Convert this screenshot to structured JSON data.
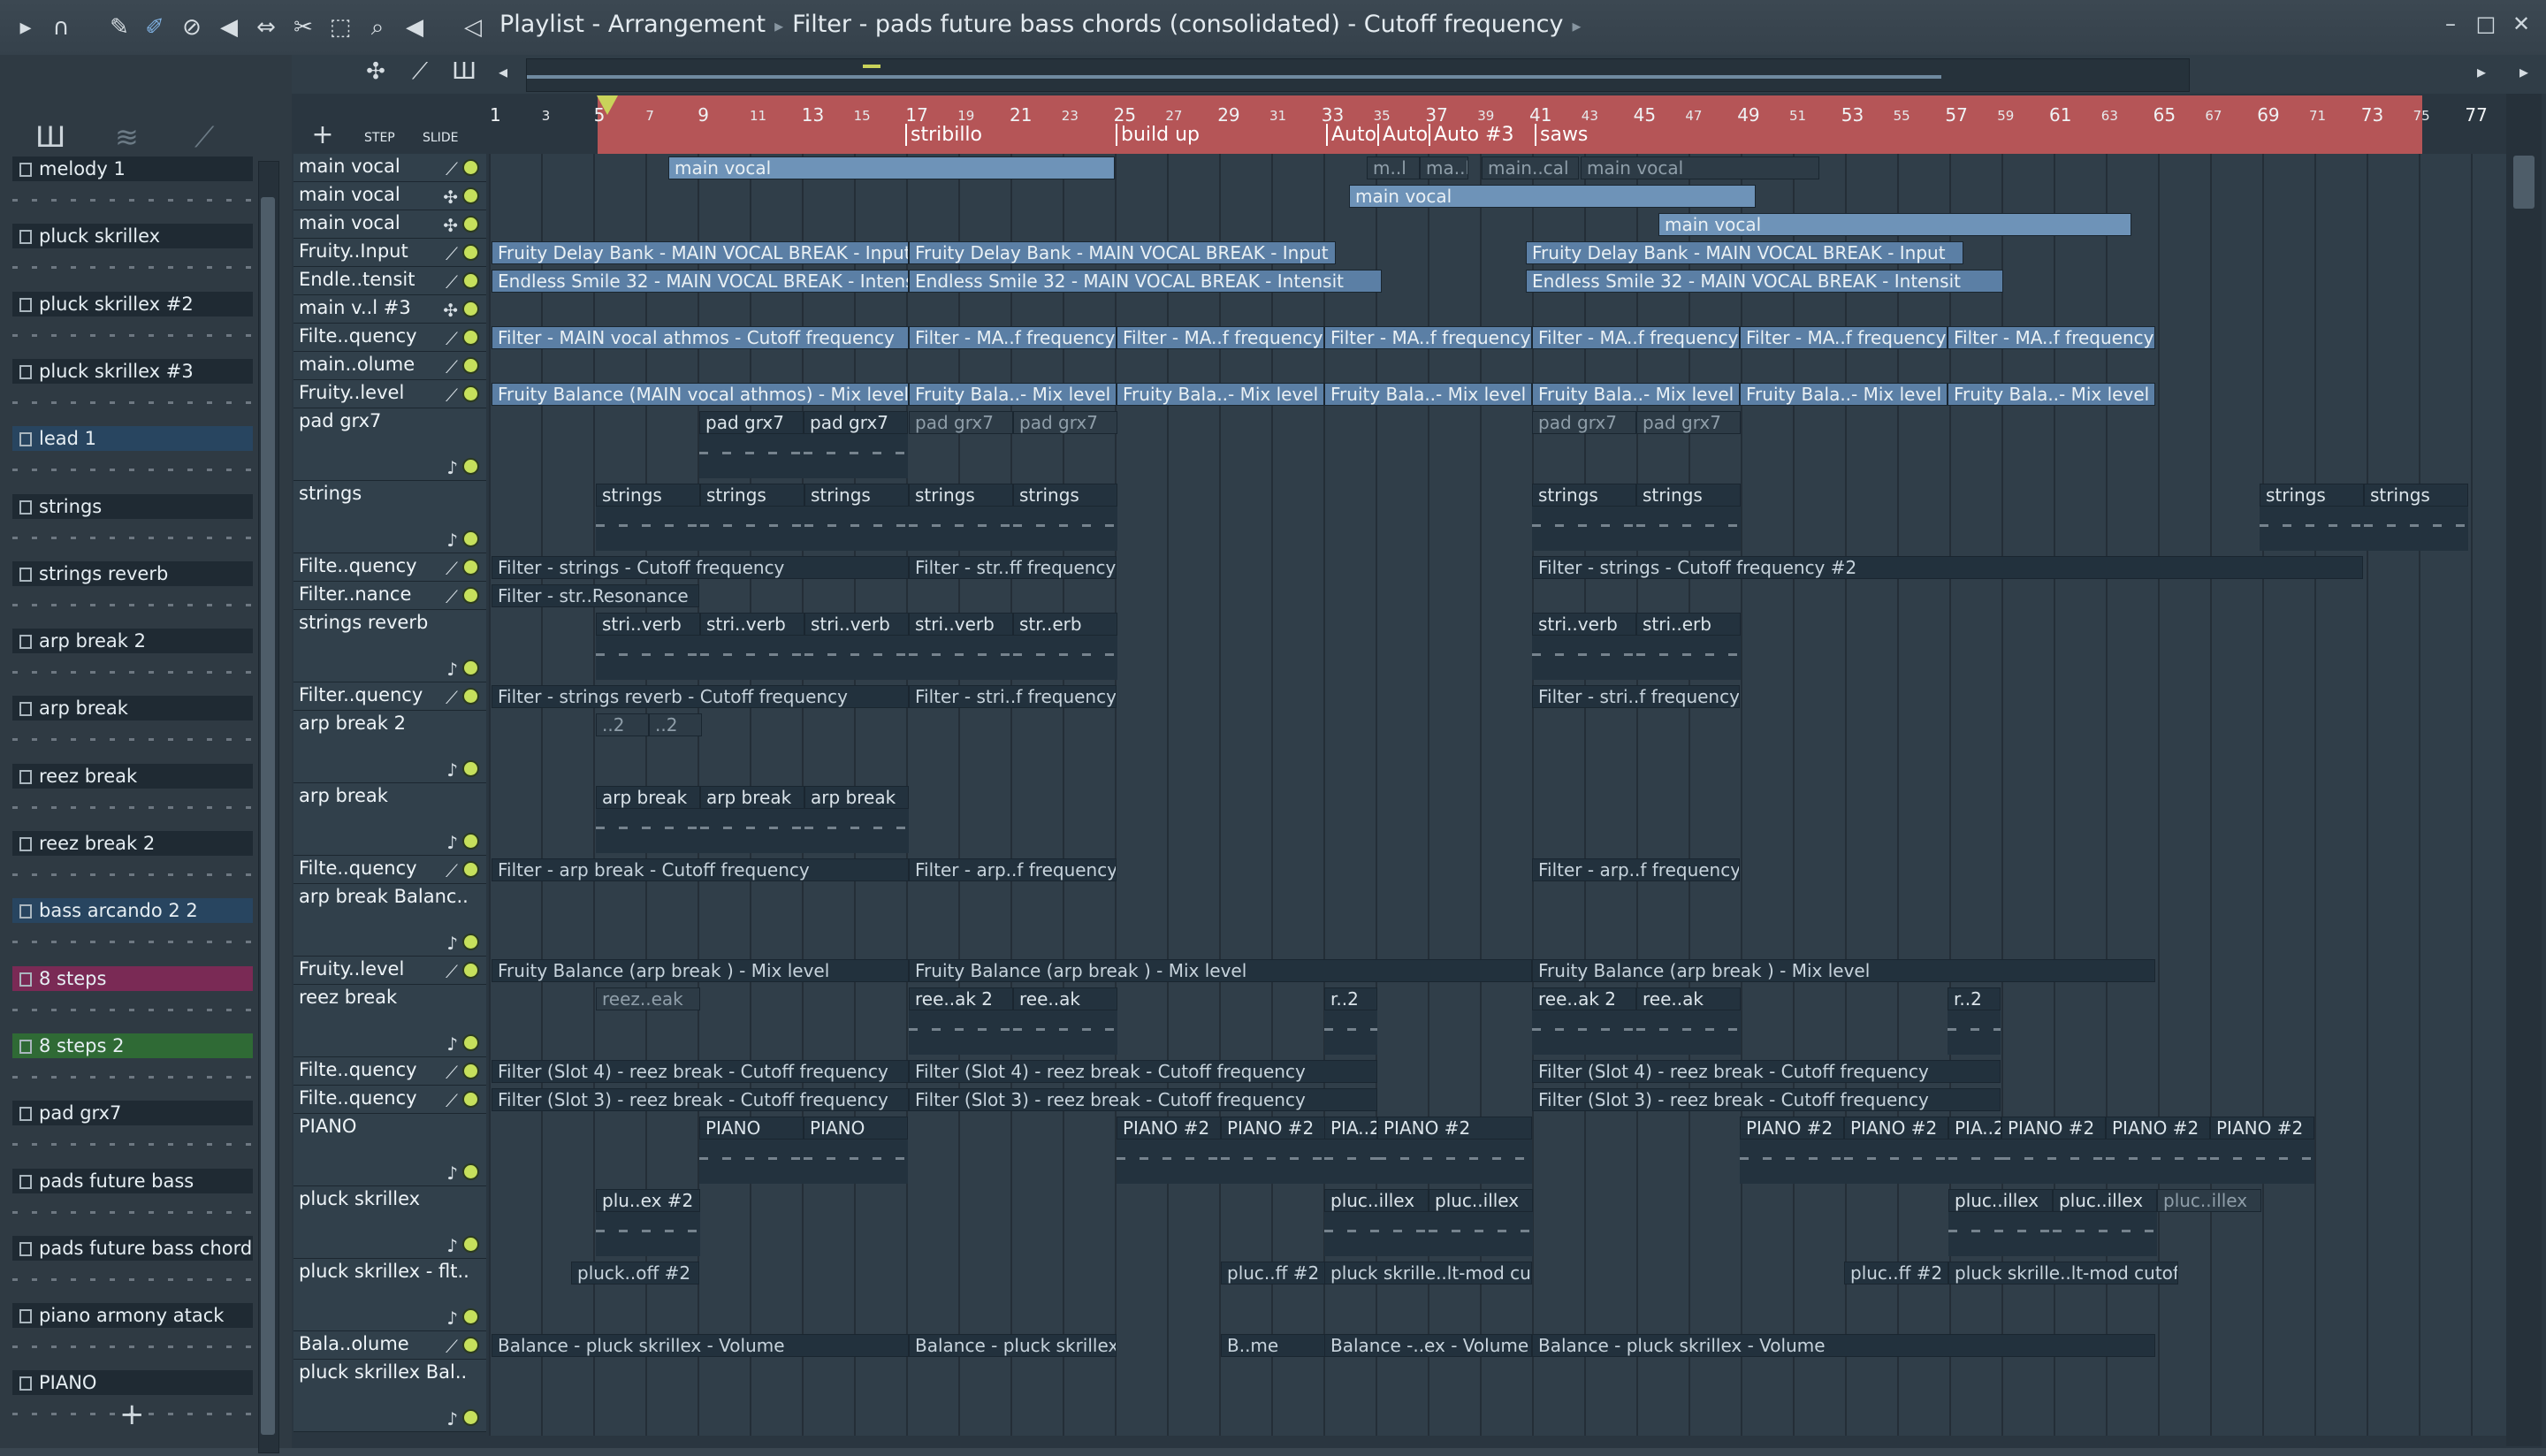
{
  "title": {
    "items": [
      "Playlist - Arrangement",
      "Filter - pads future bass chords (consolidated) - Cutoff frequency"
    ]
  },
  "browser": {
    "channels": [
      "melody 1",
      "pluck skrillex",
      "pluck skrillex #2",
      "pluck skrillex #3",
      "lead 1",
      "strings",
      "strings reverb",
      "arp break 2",
      "arp break",
      "reez break",
      "reez break  2",
      "bass arcando  2 2",
      "8 steps",
      "8 steps  2",
      "pad grx7",
      "pads future bass",
      "pads future bass chords",
      "piano armony atack",
      "PIANO"
    ]
  },
  "toolbar": {
    "step_label": "STEP",
    "slide_label": "SLIDE"
  },
  "ruler": {
    "bars": [
      "1",
      "3",
      "5",
      "7",
      "9",
      "11",
      "13",
      "15",
      "17",
      "19",
      "21",
      "23",
      "25",
      "27",
      "29",
      "31",
      "33",
      "35",
      "37",
      "39",
      "41",
      "43",
      "45",
      "47",
      "49",
      "51",
      "53",
      "55",
      "57",
      "59",
      "61",
      "63",
      "65",
      "67",
      "69",
      "71",
      "73",
      "75",
      "77"
    ],
    "markers": [
      "stribillo",
      "build up",
      "Auto",
      "Auto",
      "Auto #3",
      "saws"
    ]
  },
  "tracks": [
    {
      "name": "main vocal"
    },
    {
      "name": "main vocal"
    },
    {
      "name": "main vocal"
    },
    {
      "name": "Fruity..Input"
    },
    {
      "name": "Endle..tensit"
    },
    {
      "name": "main v..l  #3"
    },
    {
      "name": "Filte..quency"
    },
    {
      "name": "main..olume"
    },
    {
      "name": "Fruity..level"
    },
    {
      "name": "pad grx7"
    },
    {
      "name": "strings"
    },
    {
      "name": "Filte..quency"
    },
    {
      "name": "Filter..nance"
    },
    {
      "name": "strings reverb"
    },
    {
      "name": "Filter..quency"
    },
    {
      "name": "arp break 2"
    },
    {
      "name": "arp break"
    },
    {
      "name": "Filte..quency"
    },
    {
      "name": "arp break  Balanc.."
    },
    {
      "name": "Fruity..level"
    },
    {
      "name": "reez break"
    },
    {
      "name": "Filte..quency"
    },
    {
      "name": "Filte..quency"
    },
    {
      "name": "PIANO"
    },
    {
      "name": "pluck skrillex"
    },
    {
      "name": "pluck skrillex - flt.."
    },
    {
      "name": "Bala..olume"
    },
    {
      "name": "pluck skrillex Bal.."
    }
  ],
  "clips": {
    "c1": "main vocal",
    "c2": "main vocal",
    "c3": "main vocal",
    "c4": "main vocal",
    "c5": "Fruity Delay Bank - MAIN VOCAL BREAK - Input",
    "c6": "Fruity Delay Bank - MAIN VOCAL BREAK - Input",
    "c7": "Fruity Delay Bank - MAIN VOCAL BREAK - Input",
    "c8": "Endless Smile 32 - MAIN VOCAL BREAK - Intensit",
    "c9": "Endless Smile 32 - MAIN VOCAL BREAK - Intensit",
    "c10": "Endless Smile 32 - MAIN VOCAL BREAK - Intensit",
    "c11": "Filter - MAIN vocal athmos - Cutoff frequency",
    "c12": "Filter - MA..f frequency",
    "c13": "Filter - MA..f frequency",
    "c14": "Filter - MA..f frequency",
    "c15": "Filter - MA..f frequency",
    "c16": "Filter - MA..f frequency",
    "c17": "Filter - MA..f frequency",
    "c18": "Fruity Balance (MAIN vocal athmos) - Mix level",
    "c19": "Fruity Bala..- Mix level",
    "c20": "Fruity Bala..- Mix level",
    "c21": "Fruity Bala..- Mix level",
    "c22": "Fruity Bala..- Mix level",
    "c23": "Fruity Bala..- Mix level",
    "c24": "Fruity Bala..- Mix level",
    "c25": "pad grx7",
    "c26": "pad grx7",
    "c27": "pad grx7",
    "c28": "pad grx7",
    "c29": "pad grx7",
    "c30": "pad grx7",
    "c31": "strings",
    "c32": "strings",
    "c33": "strings",
    "c34": "strings",
    "c35": "strings",
    "c36": "strings",
    "c37": "strings",
    "c38": "strings",
    "c39": "strings",
    "c40": "Filter - strings - Cutoff frequency",
    "c41": "Filter - str..ff frequency",
    "c42": "Filter - strings - Cutoff frequency #2",
    "c43": "Filter - str..Resonance",
    "c44": "stri..verb",
    "c45": "stri..verb",
    "c46": "stri..verb",
    "c47": "stri..verb",
    "c48": "str..erb",
    "c49": "stri..verb",
    "c50": "stri..erb",
    "c51": "Filter - strings reverb  - Cutoff frequency",
    "c52": "Filter - stri..f frequency",
    "c53": "Filter - stri..f frequency",
    "c54": "..2",
    "c55": "..2",
    "c56": "arp break",
    "c57": "arp break",
    "c58": "arp break",
    "c59": "Filter - arp break  - Cutoff frequency",
    "c60": "Filter - arp..f frequency",
    "c61": "Filter - arp..f frequency",
    "c62": "Fruity Balance (arp break ) - Mix level",
    "c63": "Fruity Balance (arp break ) - Mix level",
    "c64": "Fruity Balance (arp break ) - Mix level",
    "c65": "reez..eak",
    "c66": "ree..ak  2",
    "c67": "ree..ak",
    "c68": "r..2",
    "c69": "ree..ak  2",
    "c70": "ree..ak",
    "c71": "r..2",
    "c72": "Filter (Slot 4) - reez break  - Cutoff frequency",
    "c73": "Filter (Slot 4) - reez break  - Cutoff frequency",
    "c74": "Filter (Slot 4) - reez break  - Cutoff frequency",
    "c75": "Filter (Slot 3) - reez break  - Cutoff frequency",
    "c76": "Filter (Slot 3) - reez break  - Cutoff frequency",
    "c77": "Filter (Slot 3) - reez break  - Cutoff frequency",
    "c78": "PIANO",
    "c79": "PIANO",
    "c80": "PIANO #2",
    "c81": "PIANO #2",
    "c82": "PIA..2",
    "c83": "PIANO #2",
    "c84": "PIANO #2",
    "c85": "PIANO #2",
    "c86": "PIA..2",
    "c87": "PIANO #2",
    "c88": "PIANO #2",
    "c89": "PIANO #2",
    "c90": "plu..ex #2",
    "c91": "pluc..illex",
    "c92": "pluc..illex",
    "c93": "pluc..illex",
    "c94": "pluc..illex",
    "c95": "pluc..illex",
    "c96": "pluck..off #2",
    "c97": "pluc..ff #2",
    "c98": "pluck skrille..lt-mod cutoff",
    "c99": "pluc..ff #2",
    "c100": "pluck skrille..lt-mod cutoff",
    "c101": "Balance - pluck skrillex - Volume",
    "c102": "Balance - pluck skrillex - Volume",
    "c103": "B..me",
    "c104": "Balance -..ex - Volume",
    "c105": "Balance - pluck skrillex - Volume",
    "c106": "m..l",
    "c107": "ma..l",
    "c108": "main..cal",
    "c109": "main vocal"
  }
}
